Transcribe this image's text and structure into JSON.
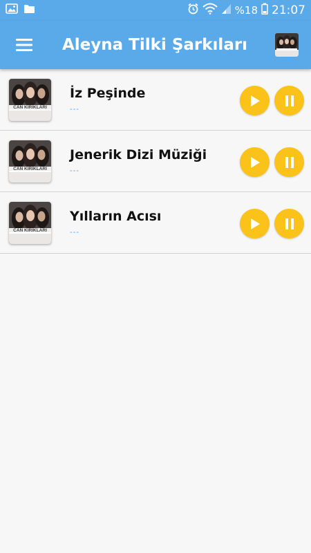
{
  "status_bar": {
    "battery_percent": "%18",
    "time": "21:07"
  },
  "app_bar": {
    "title": "Aleyna Tilki Şarkıları"
  },
  "songs": [
    {
      "title": "İz Peşinde",
      "subtitle": "---",
      "thumbnail_text": "CAN KIRIKLARI"
    },
    {
      "title": "Jenerik Dizi Müziği",
      "subtitle": "---",
      "thumbnail_text": "CAN KIRIKLARI"
    },
    {
      "title": "Yılların Acısı",
      "subtitle": "---",
      "thumbnail_text": "CAN KIRIKLARI"
    }
  ],
  "colors": {
    "primary": "#5aa9e9",
    "button": "#fbc21a",
    "background": "#f7f7f7"
  }
}
